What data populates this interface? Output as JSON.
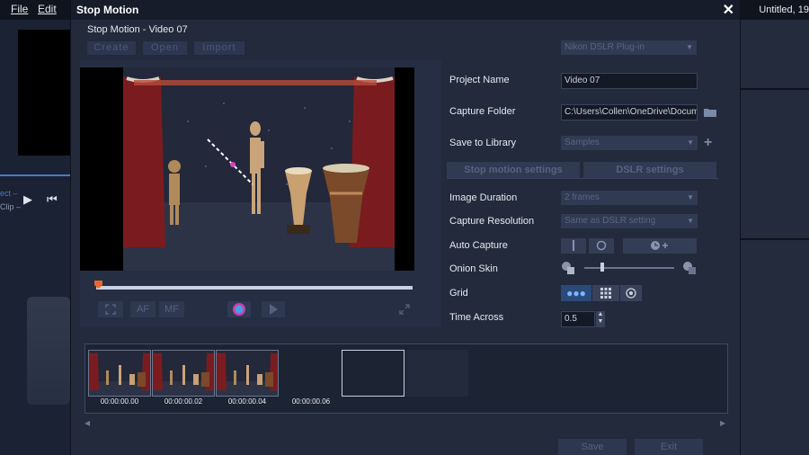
{
  "app": {
    "menu": [
      "File",
      "Edit"
    ],
    "title": "Untitled, 19",
    "side_label_1": "ect –",
    "side_label_2": "Clip –"
  },
  "dialog": {
    "title": "Stop Motion",
    "close": "✕",
    "project_label": "Stop Motion - Video 07",
    "toolbar": {
      "create": "Create",
      "open": "Open",
      "import": "Import"
    },
    "device_select": "Nikon DSLR Plug-in",
    "fields": {
      "project_name_label": "Project Name",
      "project_name_value": "Video 07",
      "capture_folder_label": "Capture Folder",
      "capture_folder_value": "C:\\Users\\Collen\\OneDrive\\Docum...",
      "save_to_library_label": "Save to Library",
      "save_to_library_value": "Samples"
    },
    "tabs": [
      "Stop motion settings",
      "DSLR settings"
    ],
    "settings": {
      "image_duration_label": "Image Duration",
      "image_duration_value": "2 frames",
      "capture_resolution_label": "Capture Resolution",
      "capture_resolution_value": "Same as DSLR setting",
      "auto_capture_label": "Auto Capture",
      "onion_skin_label": "Onion Skin",
      "onion_skin_level": 0.2,
      "grid_label": "Grid",
      "time_across_label": "Time Across",
      "time_across_value": "0.5"
    },
    "controls": {
      "af": "AF",
      "mf": "MF"
    },
    "filmstrip": {
      "timestamps": [
        "00:00:00.00",
        "00:00:00.02",
        "00:00:00.04",
        "00:00:00.06"
      ]
    },
    "bottom": {
      "save": "Save",
      "exit": "Exit"
    }
  },
  "colors": {
    "accent": "#4a78c8",
    "scrub_head": "#e8672c",
    "dialog_bg": "#222a3b"
  }
}
